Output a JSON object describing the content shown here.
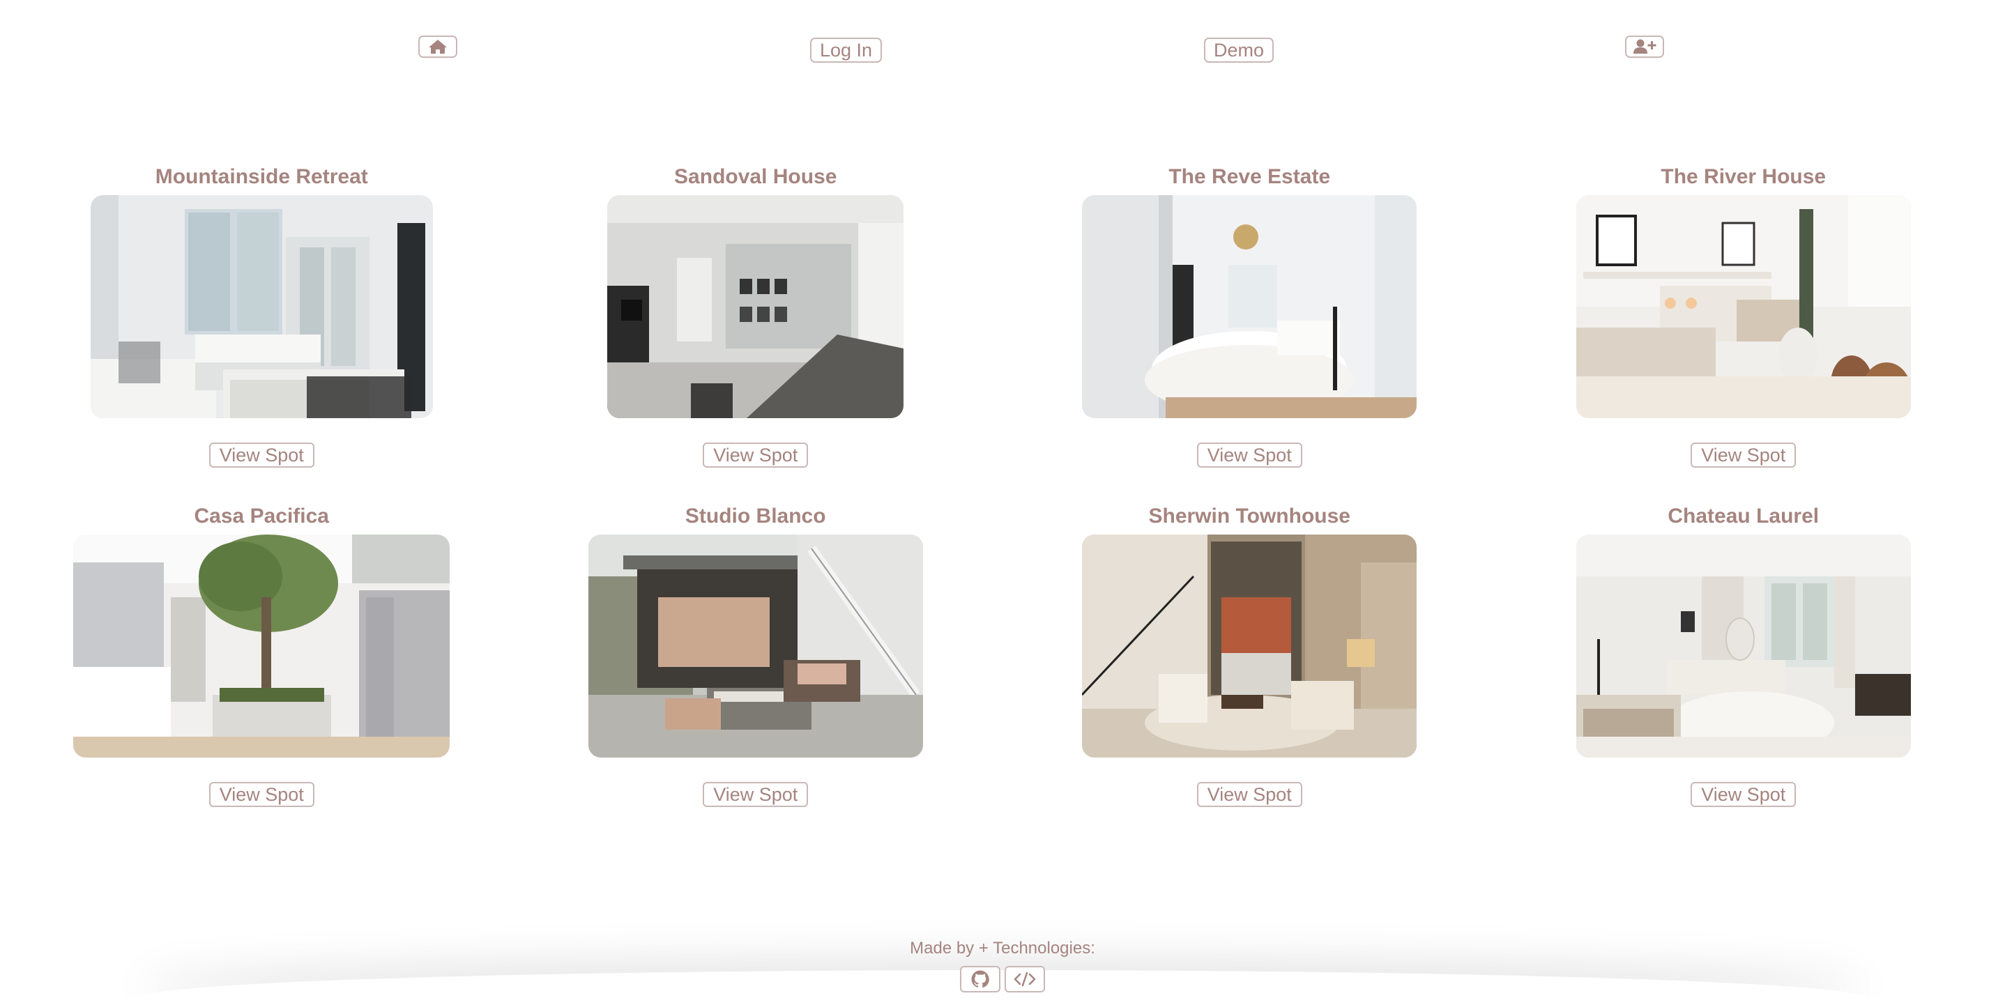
{
  "nav": {
    "home_icon": "home-icon",
    "login_label": "Log In",
    "demo_label": "Demo",
    "signup_icon": "user-plus-icon"
  },
  "spots": [
    {
      "title": "Mountainside Retreat",
      "button": "View Spot"
    },
    {
      "title": "Sandoval House",
      "button": "View Spot"
    },
    {
      "title": "The Reve Estate",
      "button": "View Spot"
    },
    {
      "title": "The River House",
      "button": "View Spot"
    },
    {
      "title": "Casa Pacifica",
      "button": "View Spot"
    },
    {
      "title": "Studio Blanco",
      "button": "View Spot"
    },
    {
      "title": "Sherwin Townhouse",
      "button": "View Spot"
    },
    {
      "title": "Chateau Laurel",
      "button": "View Spot"
    }
  ],
  "footer": {
    "label": "Made by + Technologies:",
    "github_icon": "github-icon",
    "code_icon": "code-icon"
  },
  "colors": {
    "accent": "#a5847f",
    "border": "#c9b8b5",
    "background": "#ffffff"
  }
}
